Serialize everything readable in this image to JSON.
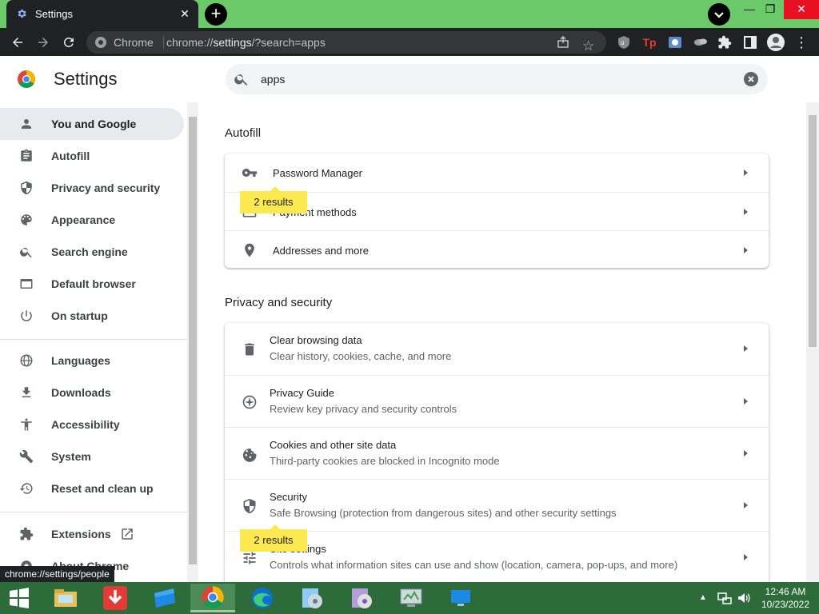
{
  "browser": {
    "tab_title": "Settings",
    "omnibox_site": "Chrome",
    "omnibox_url_prefix": "chrome://",
    "omnibox_url_bold": "settings",
    "omnibox_url_suffix": "/?search=apps"
  },
  "header": {
    "title": "Settings",
    "search_value": "apps"
  },
  "sidebar": {
    "items": [
      {
        "label": "You and Google",
        "icon": "person-icon"
      },
      {
        "label": "Autofill",
        "icon": "clipboard-icon"
      },
      {
        "label": "Privacy and security",
        "icon": "shield-icon"
      },
      {
        "label": "Appearance",
        "icon": "palette-icon"
      },
      {
        "label": "Search engine",
        "icon": "search-icon"
      },
      {
        "label": "Default browser",
        "icon": "browser-window-icon"
      },
      {
        "label": "On startup",
        "icon": "power-icon"
      },
      {
        "label": "Languages",
        "icon": "globe-icon"
      },
      {
        "label": "Downloads",
        "icon": "download-icon"
      },
      {
        "label": "Accessibility",
        "icon": "accessibility-icon"
      },
      {
        "label": "System",
        "icon": "wrench-icon"
      },
      {
        "label": "Reset and clean up",
        "icon": "history-icon"
      },
      {
        "label": "Extensions",
        "icon": "puzzle-icon"
      },
      {
        "label": "About Chrome",
        "icon": "chrome-icon"
      }
    ]
  },
  "autofill": {
    "title": "Autofill",
    "rows": [
      {
        "label": "Password Manager"
      },
      {
        "label": "Payment methods"
      },
      {
        "label": "Addresses and more"
      }
    ],
    "badge": "2 results"
  },
  "privacy": {
    "title": "Privacy and security",
    "rows": [
      {
        "label": "Clear browsing data",
        "sub": "Clear history, cookies, cache, and more"
      },
      {
        "label": "Privacy Guide",
        "sub": "Review key privacy and security controls"
      },
      {
        "label": "Cookies and other site data",
        "sub": "Third-party cookies are blocked in Incognito mode"
      },
      {
        "label": "Security",
        "sub": "Safe Browsing (protection from dangerous sites) and other security settings"
      },
      {
        "label": "Site settings",
        "sub": "Controls what information sites can use and show (location, camera, pop-ups, and more)"
      }
    ],
    "badge": "2 results"
  },
  "status_url": "chrome://settings/people",
  "taskbar": {
    "time": "12:46 AM",
    "date": "10/23/2022"
  },
  "colors": {
    "titlebar": "#6cc96a",
    "highlight": "#fce94f",
    "active_nav": "#e8eaed",
    "taskbar": "#2d6b3a"
  }
}
